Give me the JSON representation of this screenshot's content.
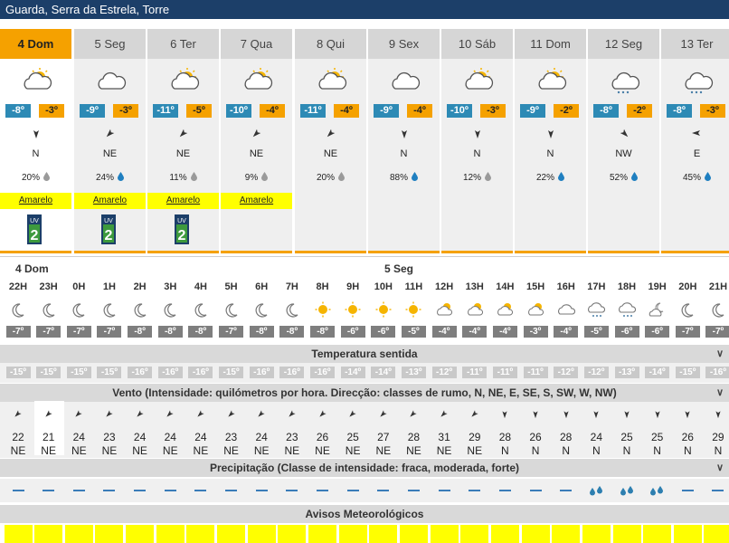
{
  "location_title": "Guarda, Serra da Estrela, Torre",
  "days": [
    {
      "label": "4 Dom",
      "icon": "partly-cloudy-icon",
      "tmin": "-8º",
      "tmax": "-3º",
      "wind_dir": "N",
      "wind_deg": 180,
      "precip": "20%",
      "drop": "grey",
      "warning": "Amarelo",
      "uv": "2",
      "active": true
    },
    {
      "label": "5 Seg",
      "icon": "cloud-icon",
      "tmin": "-9º",
      "tmax": "-3º",
      "wind_dir": "NE",
      "wind_deg": 225,
      "precip": "24%",
      "drop": "blue",
      "warning": "Amarelo",
      "uv": "2"
    },
    {
      "label": "6 Ter",
      "icon": "partly-sunny-icon",
      "tmin": "-11º",
      "tmax": "-5º",
      "wind_dir": "NE",
      "wind_deg": 225,
      "precip": "11%",
      "drop": "grey",
      "warning": "Amarelo",
      "uv": "2"
    },
    {
      "label": "7 Qua",
      "icon": "partly-sunny-icon",
      "tmin": "-10º",
      "tmax": "-4º",
      "wind_dir": "NE",
      "wind_deg": 225,
      "precip": "9%",
      "drop": "grey",
      "warning": "Amarelo",
      "uv": ""
    },
    {
      "label": "8 Qui",
      "icon": "partly-sunny-icon",
      "tmin": "-11º",
      "tmax": "-4º",
      "wind_dir": "NE",
      "wind_deg": 225,
      "precip": "20%",
      "drop": "grey",
      "warning": "",
      "uv": ""
    },
    {
      "label": "9 Sex",
      "icon": "cloud-icon",
      "tmin": "-9º",
      "tmax": "-4º",
      "wind_dir": "N",
      "wind_deg": 180,
      "precip": "88%",
      "drop": "blue",
      "warning": "",
      "uv": ""
    },
    {
      "label": "10 Sáb",
      "icon": "sun-cloud-icon",
      "tmin": "-10º",
      "tmax": "-3º",
      "wind_dir": "N",
      "wind_deg": 180,
      "precip": "12%",
      "drop": "grey",
      "warning": "",
      "uv": ""
    },
    {
      "label": "11 Dom",
      "icon": "partly-sunny-icon",
      "tmin": "-9º",
      "tmax": "-2º",
      "wind_dir": "N",
      "wind_deg": 180,
      "precip": "22%",
      "drop": "blue",
      "warning": "",
      "uv": ""
    },
    {
      "label": "12 Seg",
      "icon": "rain-cloud-icon",
      "tmin": "-8º",
      "tmax": "-2º",
      "wind_dir": "NW",
      "wind_deg": 135,
      "precip": "52%",
      "drop": "blue",
      "warning": "",
      "uv": ""
    },
    {
      "label": "13 Ter",
      "icon": "rain-cloud-icon",
      "tmin": "-8º",
      "tmax": "-3º",
      "wind_dir": "E",
      "wind_deg": 270,
      "precip": "45%",
      "drop": "blue",
      "warning": "",
      "uv": ""
    }
  ],
  "date_labels": {
    "day1": "4 Dom",
    "day2": "5 Seg"
  },
  "hours": [
    {
      "h": "22H",
      "icon": "moon-icon",
      "temp": "-7º",
      "feel": "-15º",
      "wdeg": 225,
      "speed": "22",
      "dir": "NE",
      "precip": "none"
    },
    {
      "h": "23H",
      "icon": "moon-icon",
      "temp": "-7º",
      "feel": "-15º",
      "wdeg": 225,
      "speed": "21",
      "dir": "NE",
      "precip": "none"
    },
    {
      "h": "0H",
      "icon": "moon-icon",
      "temp": "-7º",
      "feel": "-15º",
      "wdeg": 225,
      "speed": "24",
      "dir": "NE",
      "precip": "none"
    },
    {
      "h": "1H",
      "icon": "moon-icon",
      "temp": "-7º",
      "feel": "-15º",
      "wdeg": 225,
      "speed": "23",
      "dir": "NE",
      "precip": "none"
    },
    {
      "h": "2H",
      "icon": "moon-icon",
      "temp": "-8º",
      "feel": "-16º",
      "wdeg": 225,
      "speed": "24",
      "dir": "NE",
      "precip": "none"
    },
    {
      "h": "3H",
      "icon": "moon-icon",
      "temp": "-8º",
      "feel": "-16º",
      "wdeg": 225,
      "speed": "24",
      "dir": "NE",
      "precip": "none"
    },
    {
      "h": "4H",
      "icon": "moon-icon",
      "temp": "-8º",
      "feel": "-16º",
      "wdeg": 225,
      "speed": "24",
      "dir": "NE",
      "precip": "none"
    },
    {
      "h": "5H",
      "icon": "moon-icon",
      "temp": "-7º",
      "feel": "-15º",
      "wdeg": 225,
      "speed": "23",
      "dir": "NE",
      "precip": "none"
    },
    {
      "h": "6H",
      "icon": "moon-icon",
      "temp": "-8º",
      "feel": "-16º",
      "wdeg": 225,
      "speed": "24",
      "dir": "NE",
      "precip": "none"
    },
    {
      "h": "7H",
      "icon": "moon-icon",
      "temp": "-8º",
      "feel": "-16º",
      "wdeg": 225,
      "speed": "23",
      "dir": "NE",
      "precip": "none"
    },
    {
      "h": "8H",
      "icon": "sun-icon",
      "temp": "-8º",
      "feel": "-16º",
      "wdeg": 225,
      "speed": "26",
      "dir": "NE",
      "precip": "none"
    },
    {
      "h": "9H",
      "icon": "sun-icon",
      "temp": "-6º",
      "feel": "-14º",
      "wdeg": 225,
      "speed": "25",
      "dir": "NE",
      "precip": "none"
    },
    {
      "h": "10H",
      "icon": "sun-icon",
      "temp": "-6º",
      "feel": "-14º",
      "wdeg": 225,
      "speed": "27",
      "dir": "NE",
      "precip": "none"
    },
    {
      "h": "11H",
      "icon": "sun-icon",
      "temp": "-5º",
      "feel": "-13º",
      "wdeg": 225,
      "speed": "28",
      "dir": "NE",
      "precip": "none"
    },
    {
      "h": "12H",
      "icon": "partly-sunny-icon",
      "temp": "-4º",
      "feel": "-12º",
      "wdeg": 225,
      "speed": "31",
      "dir": "NE",
      "precip": "none"
    },
    {
      "h": "13H",
      "icon": "partly-sunny-icon",
      "temp": "-4º",
      "feel": "-11º",
      "wdeg": 225,
      "speed": "29",
      "dir": "NE",
      "precip": "none"
    },
    {
      "h": "14H",
      "icon": "partly-sunny-icon",
      "temp": "-4º",
      "feel": "-11º",
      "wdeg": 180,
      "speed": "28",
      "dir": "N",
      "precip": "none"
    },
    {
      "h": "15H",
      "icon": "partly-sunny-icon",
      "temp": "-3º",
      "feel": "-11º",
      "wdeg": 180,
      "speed": "26",
      "dir": "N",
      "precip": "none"
    },
    {
      "h": "16H",
      "icon": "cloud-icon",
      "temp": "-4º",
      "feel": "-12º",
      "wdeg": 180,
      "speed": "28",
      "dir": "N",
      "precip": "none"
    },
    {
      "h": "17H",
      "icon": "rain-cloud-icon",
      "temp": "-5º",
      "feel": "-12º",
      "wdeg": 180,
      "speed": "24",
      "dir": "N",
      "precip": "drops"
    },
    {
      "h": "18H",
      "icon": "rain-cloud-icon",
      "temp": "-6º",
      "feel": "-13º",
      "wdeg": 180,
      "speed": "25",
      "dir": "N",
      "precip": "drops"
    },
    {
      "h": "19H",
      "icon": "night-cloud-icon",
      "temp": "-6º",
      "feel": "-14º",
      "wdeg": 180,
      "speed": "25",
      "dir": "N",
      "precip": "drops"
    },
    {
      "h": "20H",
      "icon": "moon-icon",
      "temp": "-7º",
      "feel": "-15º",
      "wdeg": 180,
      "speed": "26",
      "dir": "N",
      "precip": "none"
    },
    {
      "h": "21H",
      "icon": "moon-icon",
      "temp": "-7º",
      "feel": "-16º",
      "wdeg": 180,
      "speed": "29",
      "dir": "N",
      "precip": "none"
    }
  ],
  "sections": {
    "feels_like": "Temperatura sentida",
    "wind": "Vento (Intensidade: quilómetros por hora. Direcção: classes de rumo, N, NE, E, SE, S, SW, W, NW)",
    "precip": "Precipitação (Classe de intensidade: fraca, moderada, forte)",
    "warnings": "Avisos Meteorológicos"
  },
  "colors": {
    "header": "#1c3f69",
    "orange": "#f5a100",
    "blue": "#2d8ab5",
    "yellow": "#ffff00"
  }
}
